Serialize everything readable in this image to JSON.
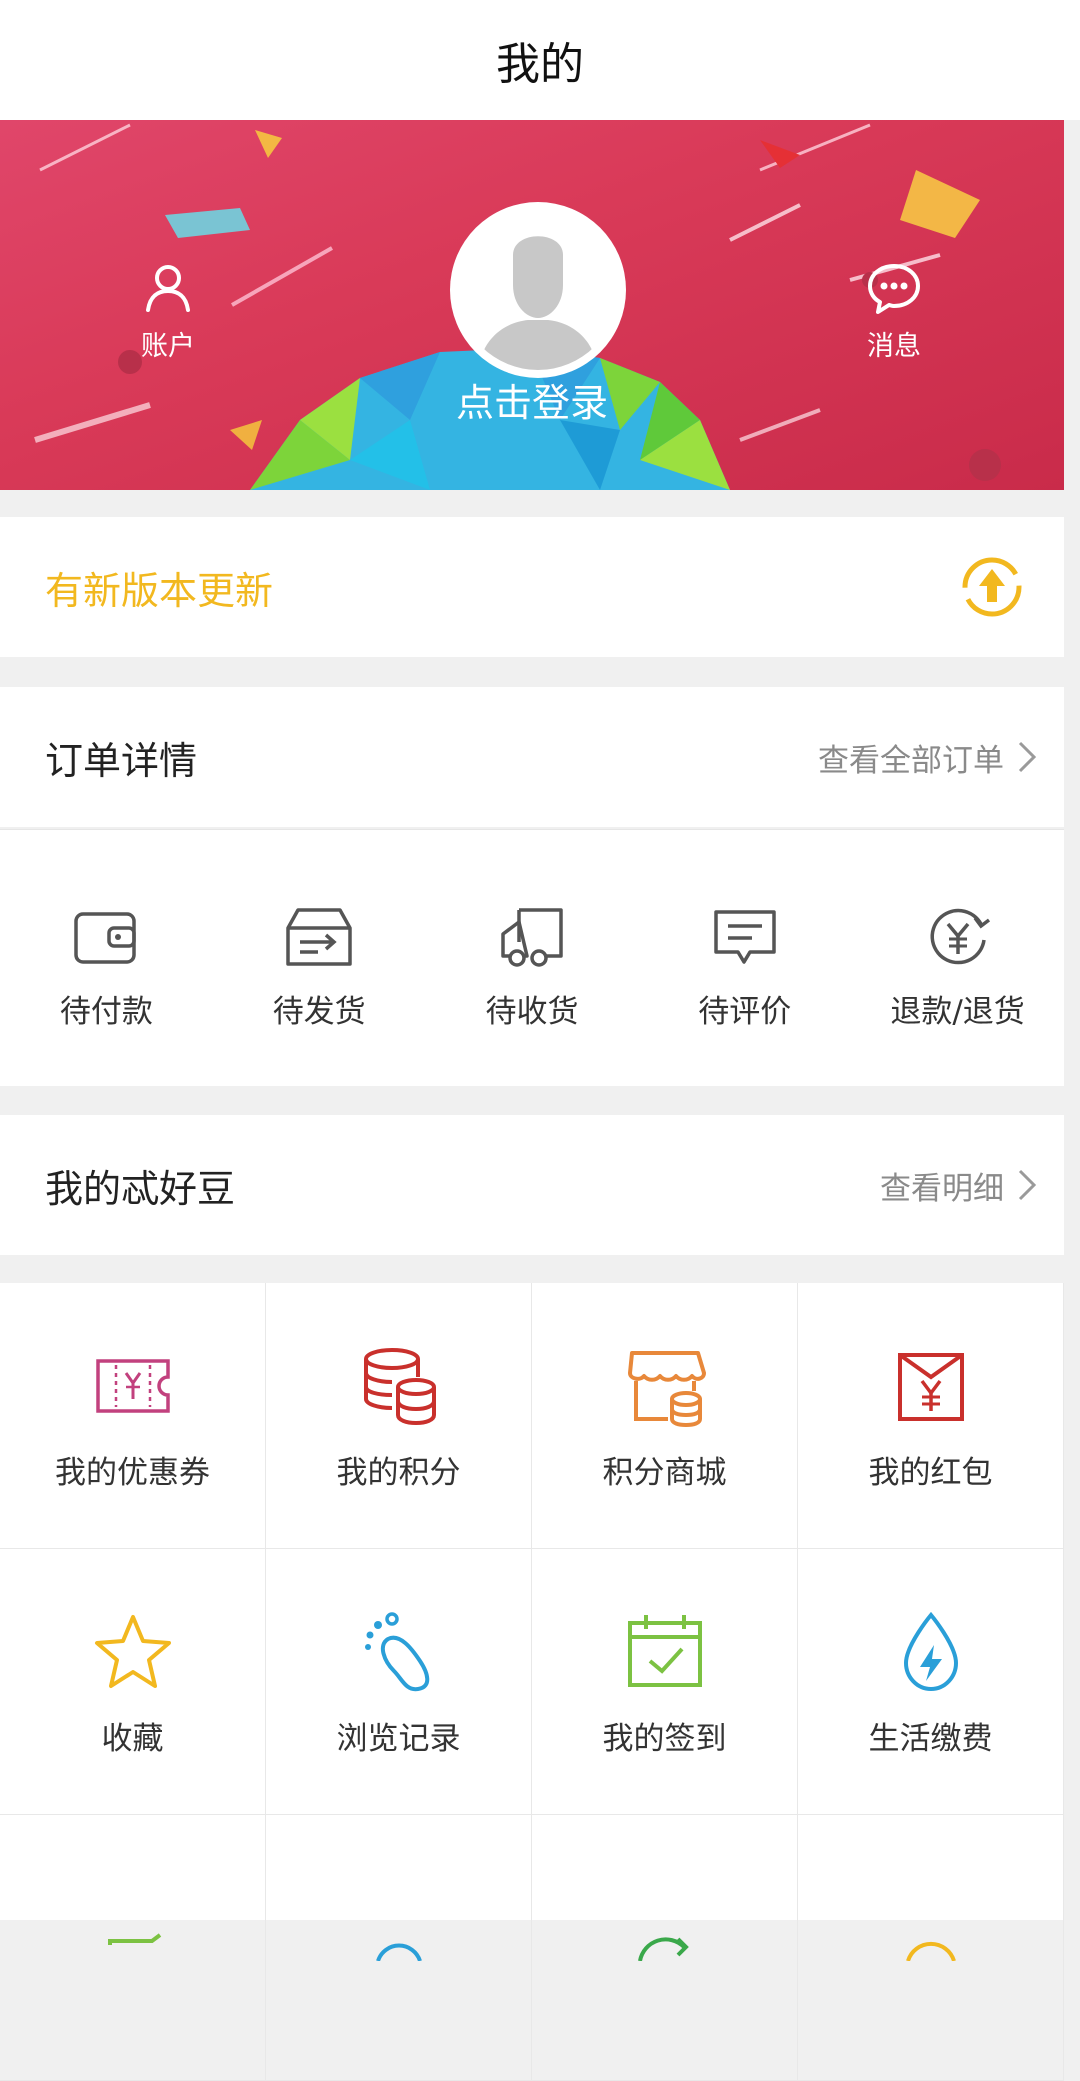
{
  "header": {
    "title": "我的"
  },
  "banner": {
    "account_label": "账户",
    "message_label": "消息",
    "login_text": "点击登录"
  },
  "update": {
    "label": "有新版本更新",
    "color": "#f2b81f"
  },
  "orders": {
    "title": "订单详情",
    "view_all": "查看全部订单",
    "items": [
      {
        "label": "待付款",
        "icon": "wallet-icon"
      },
      {
        "label": "待发货",
        "icon": "box-send-icon"
      },
      {
        "label": "待收货",
        "icon": "truck-icon"
      },
      {
        "label": "待评价",
        "icon": "comment-icon"
      },
      {
        "label": "退款/退货",
        "icon": "refund-icon"
      }
    ]
  },
  "beans": {
    "title": "我的忒好豆",
    "view_detail": "查看明细"
  },
  "services": [
    {
      "label": "我的优惠券",
      "icon": "coupon-icon",
      "color": "#c2417e"
    },
    {
      "label": "我的积分",
      "icon": "coins-icon",
      "color": "#c9302c"
    },
    {
      "label": "积分商城",
      "icon": "store-icon",
      "color": "#e8883a"
    },
    {
      "label": "我的红包",
      "icon": "red-envelope-icon",
      "color": "#c9302c"
    },
    {
      "label": "收藏",
      "icon": "star-icon",
      "color": "#f2b81f"
    },
    {
      "label": "浏览记录",
      "icon": "footprint-icon",
      "color": "#2a9fd8"
    },
    {
      "label": "我的签到",
      "icon": "calendar-check-icon",
      "color": "#7cc242"
    },
    {
      "label": "生活缴费",
      "icon": "water-drop-icon",
      "color": "#2a9fd8"
    }
  ]
}
